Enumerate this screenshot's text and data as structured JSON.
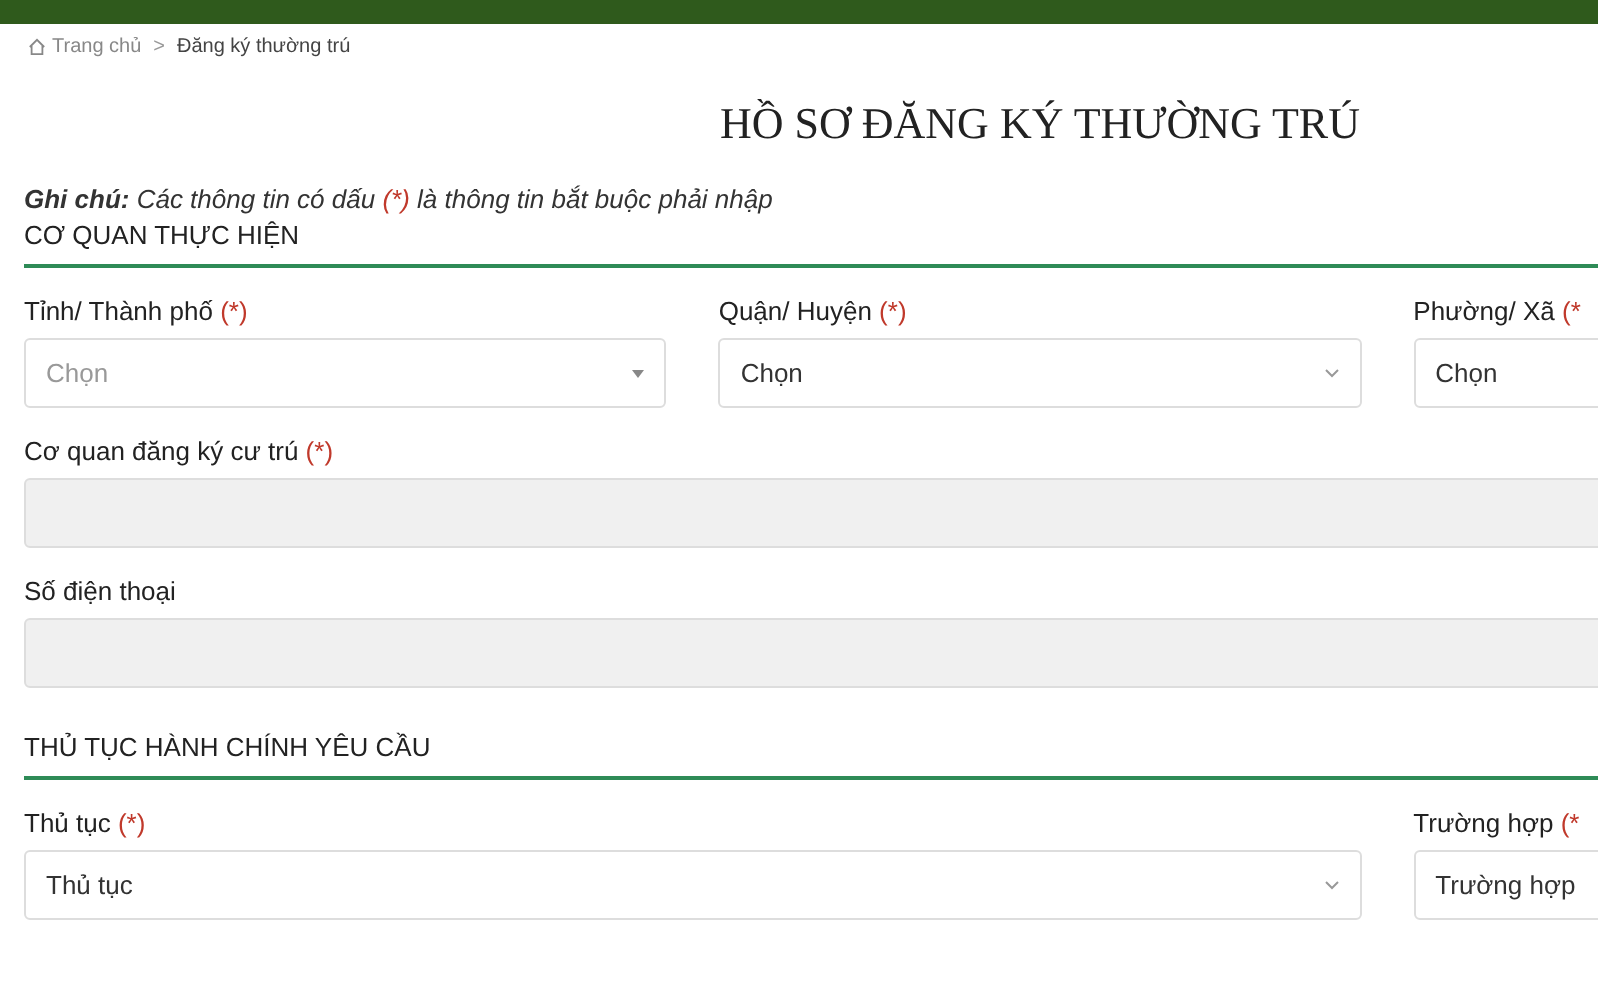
{
  "breadcrumb": {
    "items": [
      {
        "label": "Trang chủ",
        "kind": "home"
      },
      {
        "label": "Đăng ký thường trú",
        "kind": "page"
      }
    ],
    "separator": ">"
  },
  "title": "HỒ SƠ ĐĂNG KÝ THƯỜNG TRÚ",
  "note": {
    "prefix": "Ghi chú:",
    "before": "Các thông tin có dấu",
    "mark": "(*)",
    "after": "là thông tin bắt buộc phải nhập"
  },
  "sections": [
    {
      "heading": "CƠ QUAN THỰC HIỆN",
      "rows": [
        [
          {
            "label": "Tỉnh/ Thành phố",
            "required_mark": "(*)",
            "kind": "select",
            "placeholder": "Chọn"
          },
          {
            "label": "Quận/ Huyện",
            "required_mark": "(*)",
            "kind": "select",
            "value": "Chọn"
          },
          {
            "label": "Phường/ Xã",
            "required_mark": "(*",
            "kind": "select",
            "value": "Chọn"
          }
        ],
        [
          {
            "label": "Cơ quan đăng ký cư trú",
            "required_mark": "(*)",
            "kind": "text",
            "disabled": true
          }
        ],
        [
          {
            "label": "Số điện thoại",
            "kind": "text",
            "disabled": true
          }
        ]
      ]
    },
    {
      "heading": "THỦ TỤC HÀNH CHÍNH YÊU CẦU",
      "rows": [
        [
          {
            "label": "Thủ tục",
            "required_mark": "(*)",
            "kind": "select",
            "value": "Thủ tục"
          },
          {
            "label": "Trường hợp",
            "required_mark": "(*",
            "kind": "select",
            "value": "Trường hợp"
          }
        ]
      ]
    }
  ]
}
